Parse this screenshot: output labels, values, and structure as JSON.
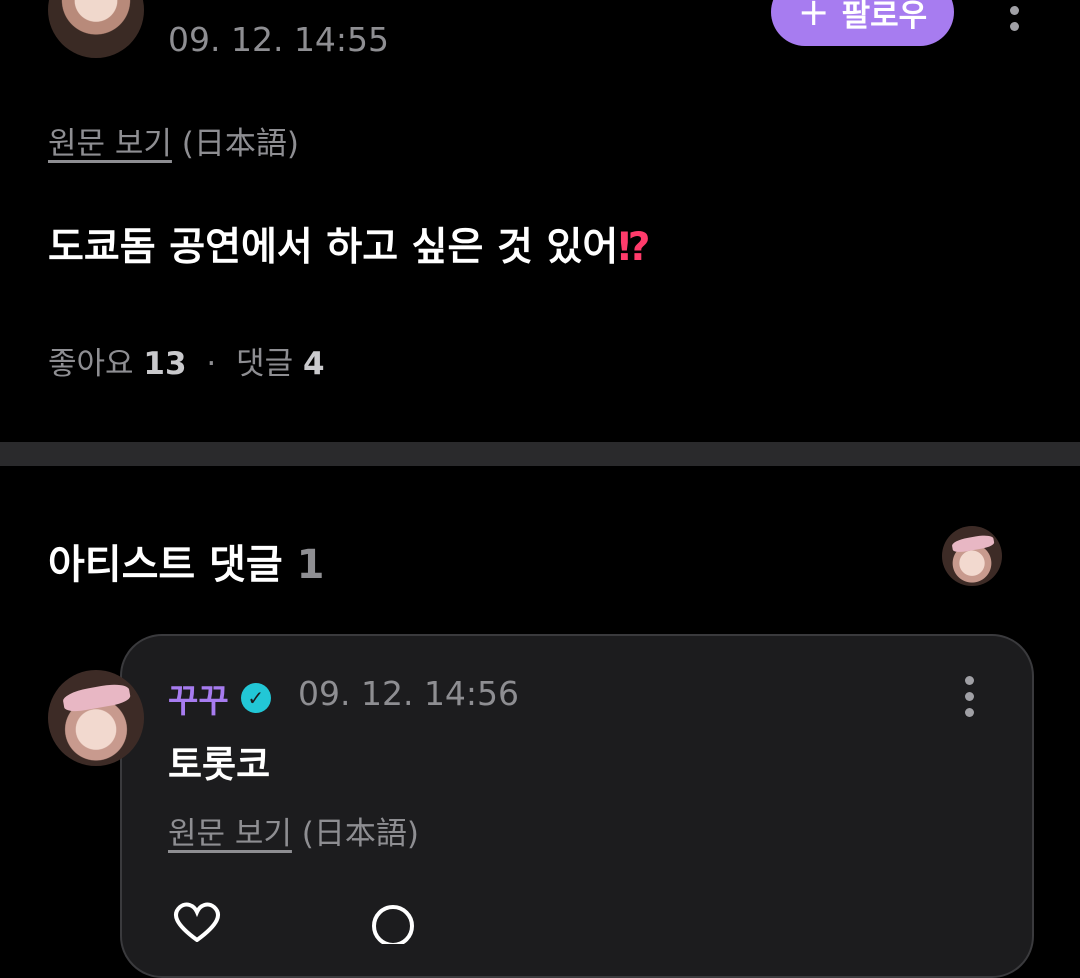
{
  "post": {
    "author_name": "",
    "date": "09. 12. 14:55",
    "follow_label": "팔로우",
    "follow_icon": "+",
    "original_link": "원문 보기",
    "original_lang": "(日本語)",
    "text": "도쿄돔 공연에서 하고 싶은 것 있어",
    "text_emoji": "⁉",
    "likes_label": "좋아요",
    "likes_count": "13",
    "dot": "·",
    "comments_label": "댓글",
    "comments_count": "4"
  },
  "artist_comments": {
    "title": "아티스트 댓글",
    "count": "1"
  },
  "comment": {
    "author": "꾸꾸",
    "verified_icon": "✓",
    "date": "09. 12. 14:56",
    "text": "토롯코",
    "original_link": "원문 보기",
    "original_lang": "(日本語)"
  },
  "colors": {
    "accent": "#a77cf0",
    "verified": "#22c7d6",
    "background": "#000000",
    "card": "#1c1c1e"
  }
}
